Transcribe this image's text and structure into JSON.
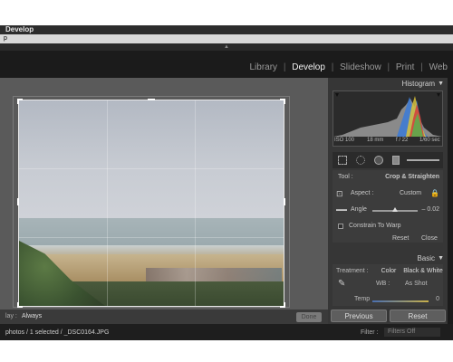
{
  "window": {
    "title": "Develop"
  },
  "menu": {
    "label": "p"
  },
  "hide_panel_glyph": "▲",
  "modules": [
    {
      "label": "Library",
      "active": false
    },
    {
      "label": "Develop",
      "active": true
    },
    {
      "label": "Slideshow",
      "active": false
    },
    {
      "label": "Print",
      "active": false
    },
    {
      "label": "Web",
      "active": false
    }
  ],
  "module_separator": "|",
  "toolbar": {
    "show_overlay_label": "lay :",
    "show_overlay_value": "Always",
    "done_label": "Done"
  },
  "filmstrip": {
    "path": "photos / 1 selected / _DSC0164.JPG",
    "filter_label": "Filter :",
    "filter_value": "Filters Off"
  },
  "histogram": {
    "title": "Histogram",
    "iso": "ISO 100",
    "focal": "18 mm",
    "aperture": "f / 22",
    "shutter": "1/60 sec"
  },
  "crop_tool": {
    "tool_label": "Tool :",
    "tool_value": "Crop & Straighten",
    "aspect_label": "Aspect :",
    "aspect_value": "Custom",
    "angle_label": "Angle",
    "angle_value": "– 0.02",
    "angle_fraction": 0.5,
    "constrain_label": "Constrain To Warp",
    "reset_label": "Reset",
    "close_label": "Close"
  },
  "basic": {
    "title": "Basic",
    "treatment_label": "Treatment :",
    "color_label": "Color",
    "bw_label": "Black & White",
    "wb_label": "WB :",
    "wb_value": "As Shot",
    "temp_label": "Temp",
    "temp_value": "0"
  },
  "footer_buttons": {
    "previous": "Previous",
    "reset": "Reset"
  },
  "colors": {
    "panel_bg": "#363636",
    "module_bar": "#1b1b1b",
    "active_module": "#f2f2f2",
    "workspace": "#5a5a5a"
  }
}
